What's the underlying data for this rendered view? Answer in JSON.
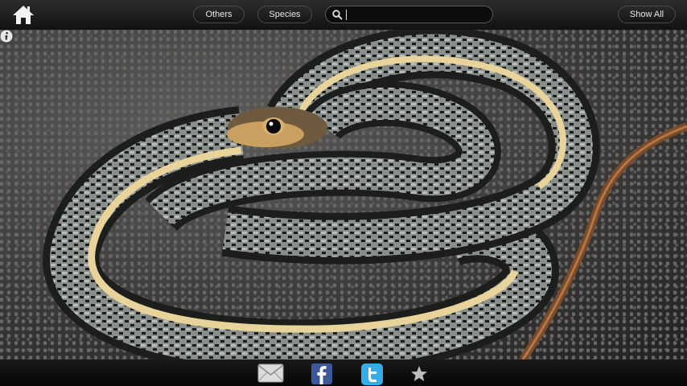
{
  "toolbar": {
    "others_label": "Others",
    "species_label": "Species",
    "show_all_label": "Show All",
    "search_value": ""
  },
  "icons": {
    "home": "home-icon",
    "search": "search-icon",
    "info": "info-icon",
    "mail": "mail-icon",
    "facebook": "facebook-icon",
    "twitter": "twitter-icon",
    "favorite": "star-icon"
  },
  "colors": {
    "bar_background": "#1a1a1a",
    "facebook_blue": "#3b5998",
    "twitter_blue": "#33aee8"
  }
}
